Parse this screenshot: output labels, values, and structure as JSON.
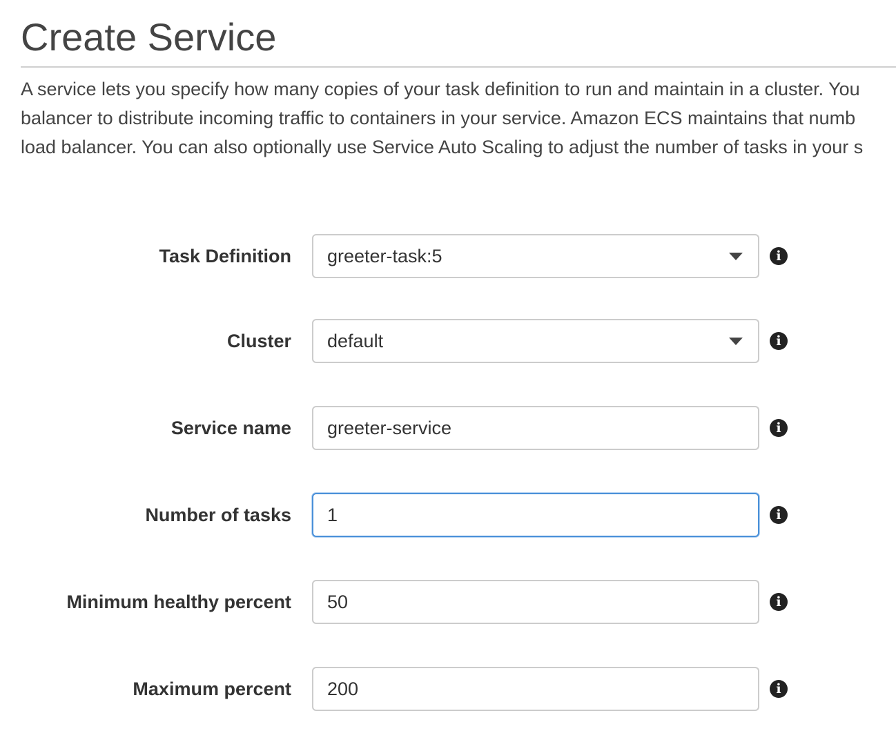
{
  "page": {
    "title": "Create Service",
    "description_lines": [
      "A service lets you specify how many copies of your task definition to run and maintain in a cluster. You",
      "balancer to distribute incoming traffic to containers in your service. Amazon ECS maintains that numb",
      "load balancer. You can also optionally use Service Auto Scaling to adjust the number of tasks in your s"
    ]
  },
  "form": {
    "task_definition": {
      "label": "Task Definition",
      "value": "greeter-task:5"
    },
    "cluster": {
      "label": "Cluster",
      "value": "default"
    },
    "service_name": {
      "label": "Service name",
      "value": "greeter-service"
    },
    "number_of_tasks": {
      "label": "Number of tasks",
      "value": "1"
    },
    "minimum_healthy_percent": {
      "label": "Minimum healthy percent",
      "value": "50"
    },
    "maximum_percent": {
      "label": "Maximum percent",
      "value": "200"
    }
  },
  "icons": {
    "info": "info-icon",
    "dropdown": "caret-down-icon"
  },
  "colors": {
    "focus_border": "#4a90d9",
    "field_border": "#cccccc",
    "label_text": "#333333"
  }
}
